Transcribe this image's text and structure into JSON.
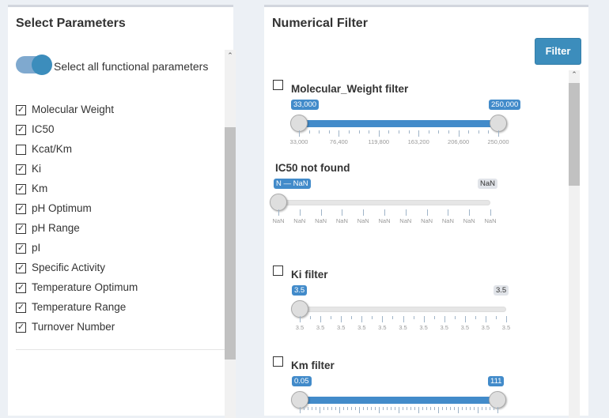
{
  "left": {
    "title": "Select Parameters",
    "toggle_label": "Select all functional parameters",
    "toggle_on": true,
    "params": [
      {
        "label": "Molecular Weight",
        "checked": true
      },
      {
        "label": "IC50",
        "checked": true
      },
      {
        "label": "Kcat/Km",
        "checked": false
      },
      {
        "label": "Ki",
        "checked": true
      },
      {
        "label": "Km",
        "checked": true
      },
      {
        "label": "pH Optimum",
        "checked": true
      },
      {
        "label": "pH Range",
        "checked": true
      },
      {
        "label": "pI",
        "checked": true
      },
      {
        "label": "Specific Activity",
        "checked": true
      },
      {
        "label": "Temperature Optimum",
        "checked": true
      },
      {
        "label": "Temperature Range",
        "checked": true
      },
      {
        "label": "Turnover Number",
        "checked": true
      }
    ]
  },
  "right": {
    "title": "Numerical Filter",
    "filter_button": "Filter",
    "filters": [
      {
        "title": "Molecular_Weight filter",
        "checkbox": true,
        "from": "33,000",
        "to": "250,000",
        "from_frac": 0,
        "to_frac": 1,
        "range_filled": true,
        "tick_labels": [
          "33,000",
          "76,400",
          "119,800",
          "163,200",
          "206,600",
          "250,000"
        ]
      },
      {
        "title": "IC50 not found",
        "checkbox": false,
        "from": "N — NaN",
        "to": "NaN",
        "from_frac": 0,
        "to_frac": 0,
        "range_filled": false,
        "tick_labels": [
          "NaN",
          "NaN",
          "NaN",
          "NaN",
          "NaN",
          "NaN",
          "NaN",
          "NaN",
          "NaN",
          "NaN",
          "NaN"
        ]
      },
      {
        "title": "Ki filter",
        "checkbox": true,
        "from": "3.5",
        "to": "3.5",
        "from_frac": 0,
        "to_frac": 0,
        "range_filled": false,
        "tick_labels": [
          "3.5",
          "3.5",
          "3.5",
          "3.5",
          "3.5",
          "3.5",
          "3.5",
          "3.5",
          "3.5",
          "3.5",
          "3.5"
        ]
      },
      {
        "title": "Km filter",
        "checkbox": true,
        "from": "0.05",
        "to": "111",
        "from_frac": 0,
        "to_frac": 1,
        "range_filled": true,
        "tick_labels": []
      }
    ]
  }
}
